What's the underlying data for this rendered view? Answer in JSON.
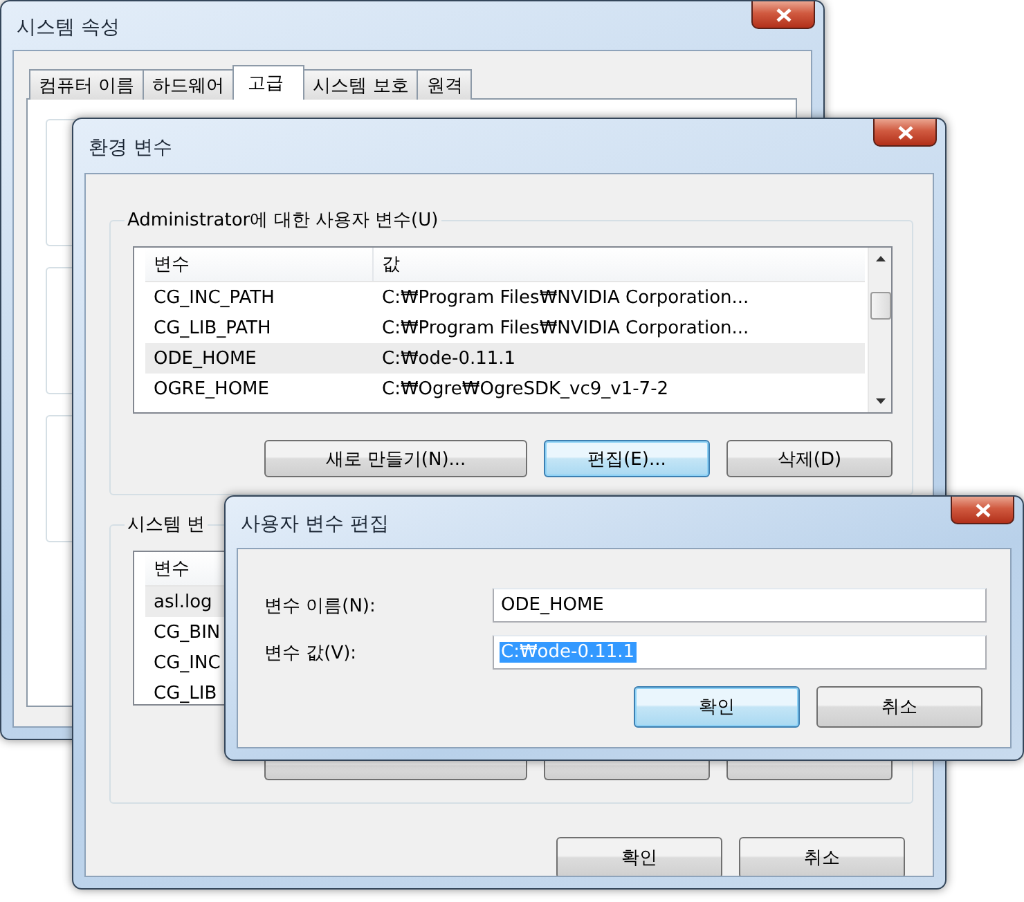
{
  "system_properties": {
    "title": "시스템 속성",
    "tabs": [
      {
        "label": "컴퓨터 이름",
        "selected": false
      },
      {
        "label": "하드웨어",
        "selected": false
      },
      {
        "label": "고급",
        "selected": true
      },
      {
        "label": "시스템 보호",
        "selected": false
      },
      {
        "label": "원격",
        "selected": false
      }
    ]
  },
  "environment_variables": {
    "title": "환경 변수",
    "user_variables": {
      "label": "Administrator에 대한 사용자 변수(U)",
      "columns": [
        "변수",
        "값"
      ],
      "rows": [
        {
          "name": "CG_INC_PATH",
          "value": "C:₩Program Files₩NVIDIA Corporation...",
          "selected": false
        },
        {
          "name": "CG_LIB_PATH",
          "value": "C:₩Program Files₩NVIDIA Corporation...",
          "selected": false
        },
        {
          "name": "ODE_HOME",
          "value": "C:₩ode-0.11.1",
          "selected": true
        },
        {
          "name": "OGRE_HOME",
          "value": "C:₩Ogre₩OgreSDK_vc9_v1-7-2",
          "selected": false
        }
      ],
      "buttons": [
        {
          "label": "새로 만들기(N)...",
          "default": false
        },
        {
          "label": "편집(E)...",
          "default": true
        },
        {
          "label": "삭제(D)",
          "default": false
        }
      ]
    },
    "system_variables": {
      "label": "시스템 변",
      "columns": [
        "변수"
      ],
      "rows": [
        {
          "name": "asl.log",
          "selected": true
        },
        {
          "name": "CG_BIN",
          "selected": false
        },
        {
          "name": "CG_INC",
          "selected": false
        },
        {
          "name": "CG_LIB",
          "selected": false
        }
      ]
    },
    "buttons": [
      {
        "label": "확인",
        "default": false
      },
      {
        "label": "취소",
        "default": false
      }
    ]
  },
  "edit_dialog": {
    "title": "사용자 변수 편집",
    "fields": [
      {
        "label": "변수 이름(N):",
        "value": "ODE_HOME",
        "selected": false
      },
      {
        "label": "변수 값(V):",
        "value": "C:₩ode-0.11.1",
        "selected": true
      }
    ],
    "buttons": [
      {
        "label": "확인",
        "default": true
      },
      {
        "label": "취소",
        "default": false
      }
    ]
  }
}
